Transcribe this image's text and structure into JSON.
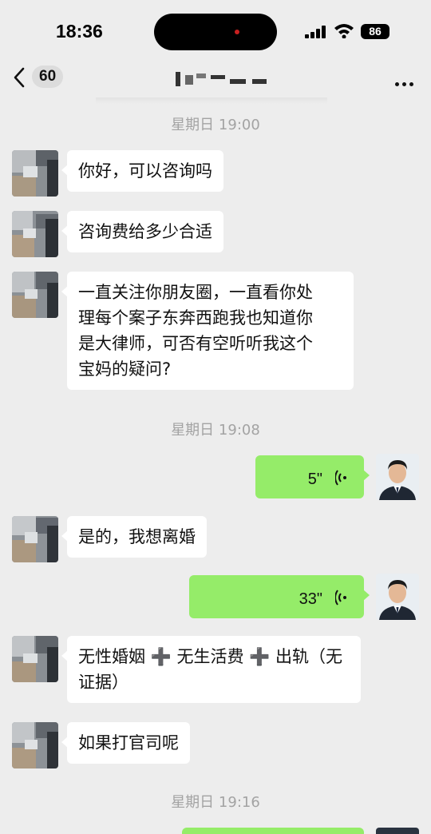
{
  "status_bar": {
    "time": "18:36",
    "battery": "86"
  },
  "nav": {
    "back_count": "60"
  },
  "timestamps": [
    "星期日 19:00",
    "星期日 19:08",
    "星期日 19:16"
  ],
  "messages": [
    {
      "from": "other",
      "text": "你好，可以咨询吗"
    },
    {
      "from": "other",
      "text": "咨询费给多少合适"
    },
    {
      "from": "other",
      "lines": [
        "一直关注你朋友圈，一直看你处",
        "理每个案子东奔西跑我也知道你",
        "是大律师，可否有空听听我这个",
        "宝妈的疑问?"
      ]
    },
    {
      "from": "me",
      "type": "voice",
      "duration": "5\""
    },
    {
      "from": "other",
      "text": "是的，我想离婚"
    },
    {
      "from": "me",
      "type": "voice",
      "duration": "33\""
    },
    {
      "from": "other",
      "lines": [
        "无性婚姻 ➕ 无生活费 ➕ 出轨（无",
        "证据）"
      ]
    },
    {
      "from": "other",
      "text": "如果打官司呢"
    }
  ],
  "icons": {
    "voice": "voice-wave-icon",
    "back": "chevron-left-icon",
    "more": "more-dots-icon"
  },
  "colors": {
    "background": "#ededed",
    "my_bubble": "#95ec69",
    "other_bubble": "#ffffff",
    "timestamp": "#a3a3a3"
  }
}
